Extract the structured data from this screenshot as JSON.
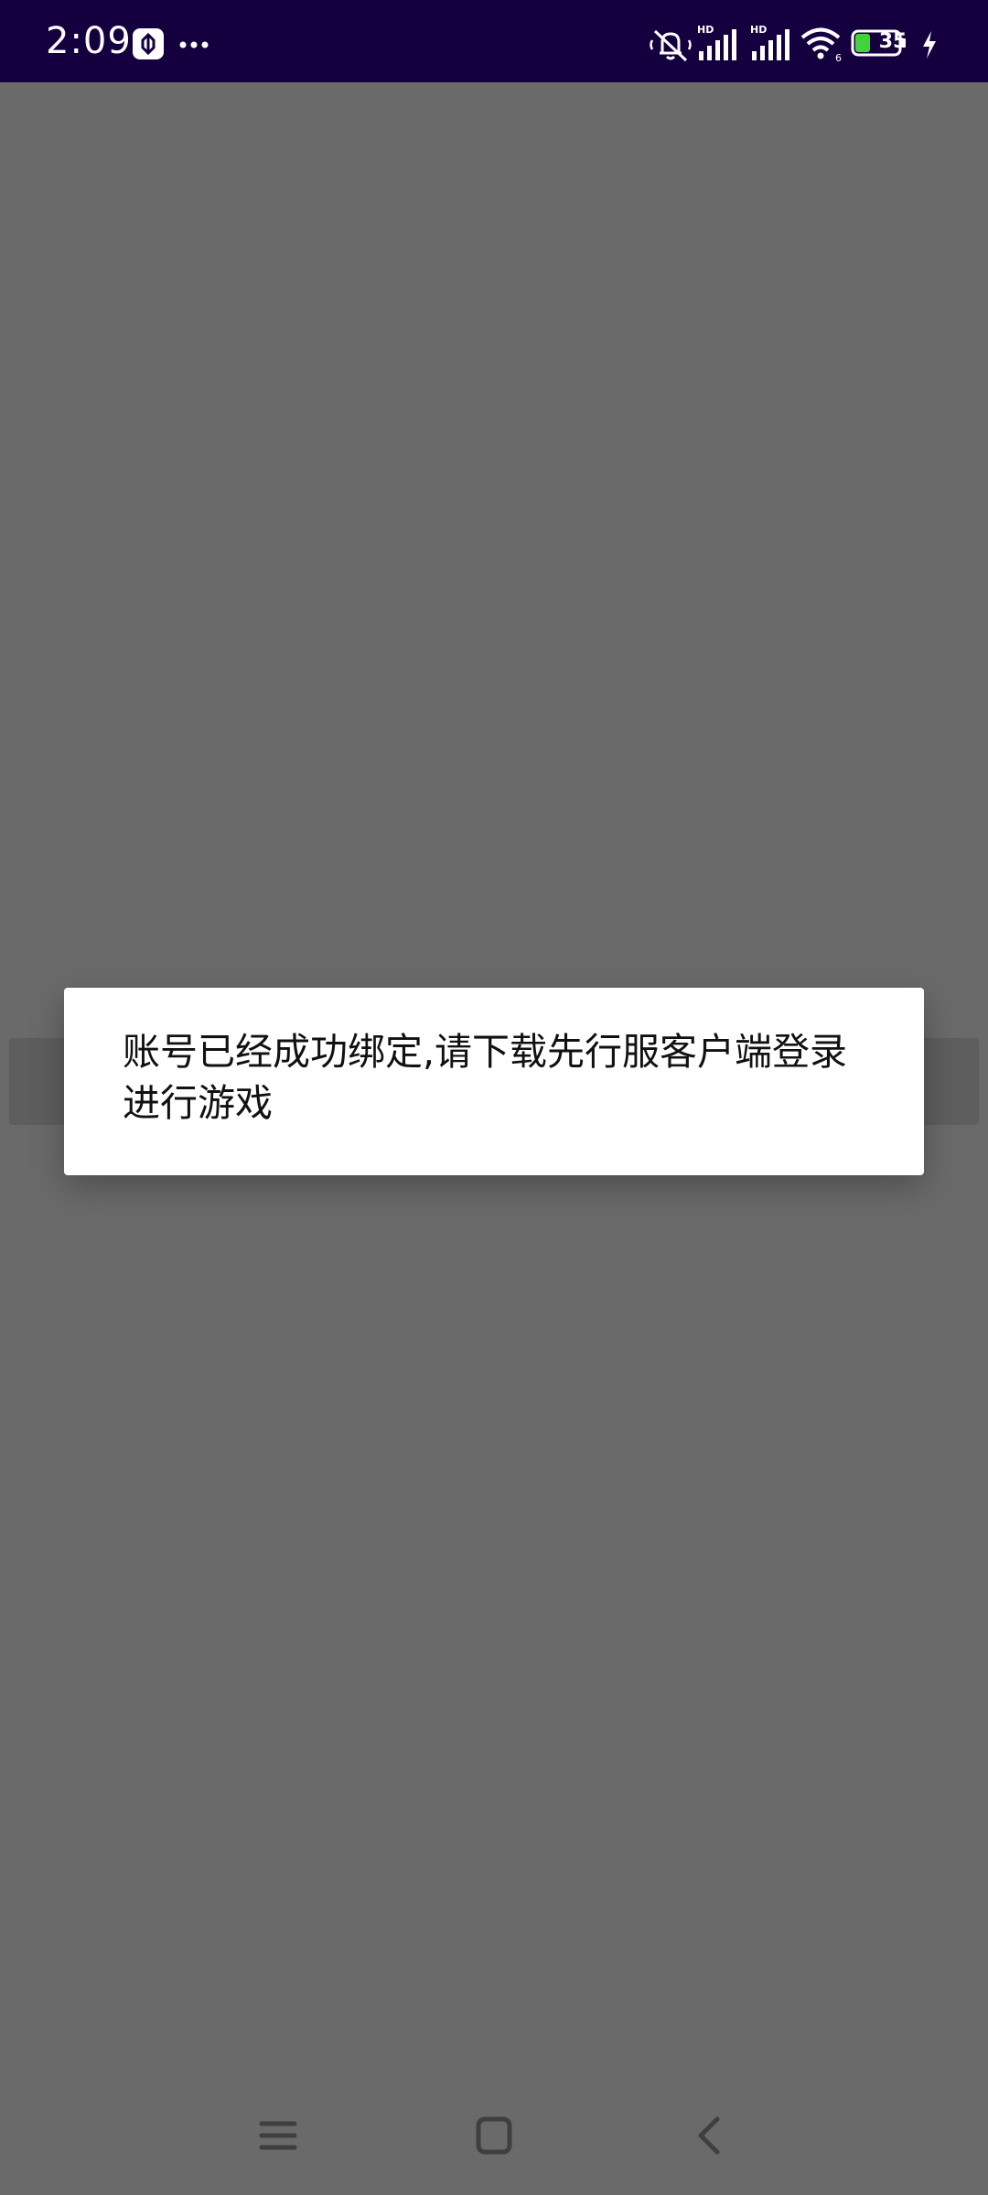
{
  "status_bar": {
    "time": "2:09",
    "battery_level": "35",
    "network_labels": [
      "HD",
      "HD"
    ],
    "icons": [
      "app-notification-icon",
      "more-dots-icon",
      "mute-icon",
      "signal-icon",
      "signal-icon",
      "wifi-icon",
      "battery-icon",
      "charging-icon"
    ]
  },
  "dialog": {
    "message": "账号已经成功绑定,请下载先行服客户端登录进行游戏"
  },
  "nav_bar": {
    "icons": [
      "menu-icon",
      "home-icon",
      "back-icon"
    ]
  },
  "colors": {
    "status_bar": "#15003f",
    "scrim": "#6a6a6a",
    "dialog": "#ffffff",
    "battery_fill": "#3ed43a"
  }
}
